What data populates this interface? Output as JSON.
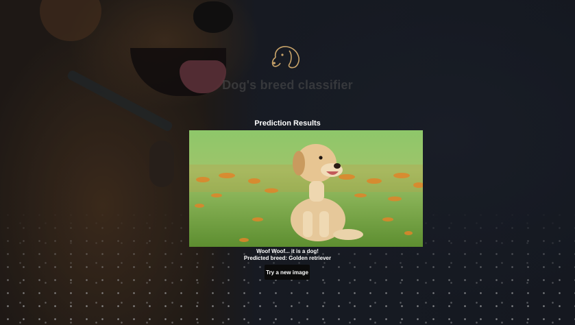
{
  "header": {
    "logo_icon": "dog-head-icon",
    "app_title": "Dog's breed classifier"
  },
  "results": {
    "title": "Prediction Results",
    "message": "Woof Woof... it is a dog!",
    "prediction": "Predicted breed: Golden retriever",
    "try_again_label": "Try a new image"
  },
  "colors": {
    "logo_stroke": "#c9a46a",
    "button_bg": "#0b0b0b",
    "text": "#ffffff"
  }
}
